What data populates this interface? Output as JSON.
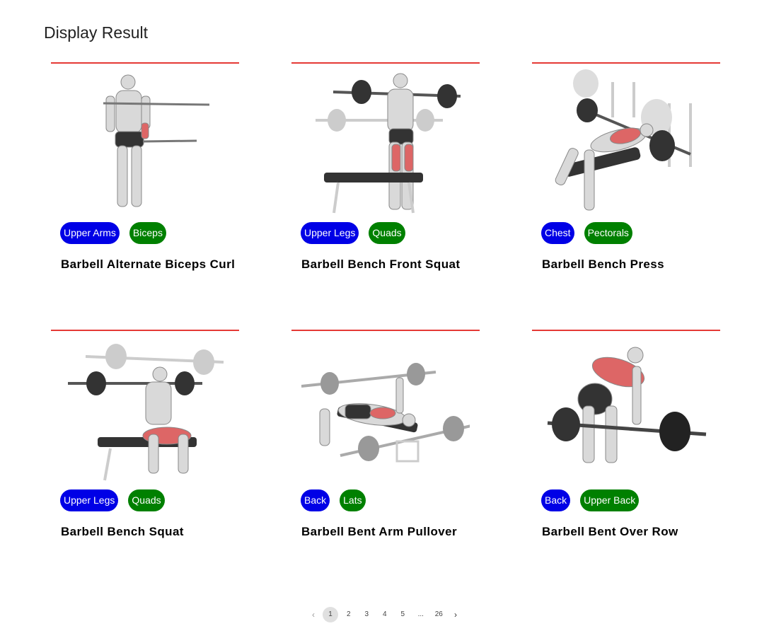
{
  "page": {
    "title": "Display Result"
  },
  "colors": {
    "body_part_tag": "#0000e6",
    "target_tag": "#008000",
    "divider": "#e53935"
  },
  "exercises": [
    {
      "name": "Barbell Alternate Biceps Curl",
      "body_part": "Upper Arms",
      "target": "Biceps",
      "illustration": "standing-biceps-curl-figure"
    },
    {
      "name": "Barbell Bench Front Squat",
      "body_part": "Upper Legs",
      "target": "Quads",
      "illustration": "front-squat-figure"
    },
    {
      "name": "Barbell Bench Press",
      "body_part": "Chest",
      "target": "Pectorals",
      "illustration": "bench-press-figure"
    },
    {
      "name": "Barbell Bench Squat",
      "body_part": "Upper Legs",
      "target": "Quads",
      "illustration": "bench-squat-figure"
    },
    {
      "name": "Barbell Bent Arm Pullover",
      "body_part": "Back",
      "target": "Lats",
      "illustration": "pullover-figure"
    },
    {
      "name": "Barbell Bent Over Row",
      "body_part": "Back",
      "target": "Upper Back",
      "illustration": "bent-over-row-figure"
    }
  ],
  "pagination": {
    "prev": "‹",
    "pages": [
      "1",
      "2",
      "3",
      "4",
      "5",
      "...",
      "26"
    ],
    "current": "1",
    "next": "›"
  }
}
